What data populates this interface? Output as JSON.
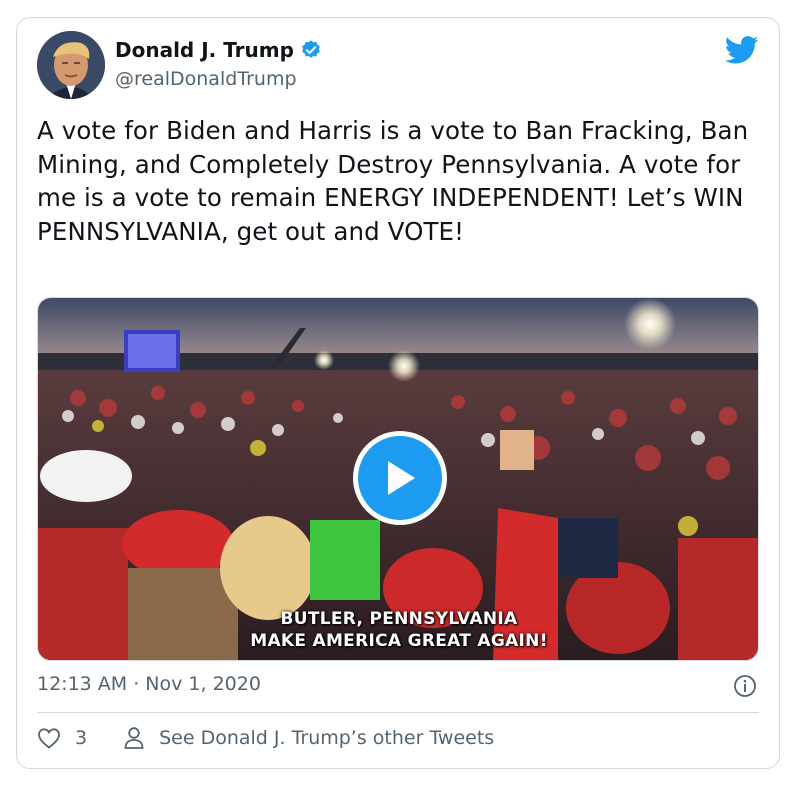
{
  "tweet": {
    "author_name": "Donald J. Trump",
    "handle": "@realDonaldTrump",
    "text": "A vote for Biden and Harris is a vote to Ban Fracking, Ban Mining, and Completely Destroy Pennsylvania. A vote for me is a vote to remain ENERGY INDEPENDENT! Let’s WIN PENNSYLVANIA, get out and VOTE!",
    "timestamp": "12:13 AM · Nov 1, 2020",
    "like_count": "3",
    "other_tweets_label": "See Donald J. Trump’s other Tweets"
  },
  "video": {
    "caption_line1": "BUTLER, PENNSYLVANIA",
    "caption_line2": "MAKE AMERICA GREAT AGAIN!"
  },
  "colors": {
    "accent": "#1d9bf0",
    "secondary_text": "#536471",
    "border": "#cfd9de"
  },
  "icons": [
    "verified-badge-icon",
    "twitter-bird-icon",
    "play-icon",
    "info-icon",
    "heart-icon",
    "person-icon"
  ]
}
